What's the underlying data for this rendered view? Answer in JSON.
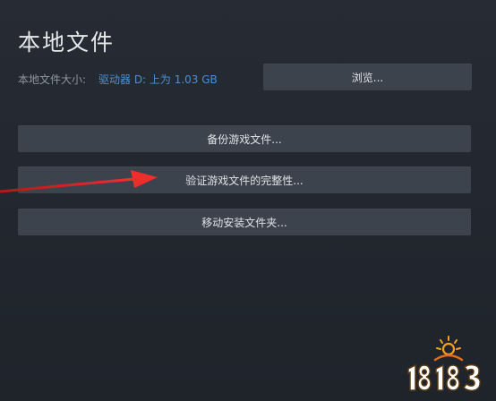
{
  "dialog": {
    "title": "本地文件",
    "size_label": "本地文件大小:",
    "size_value": "驱动器 D: 上为 1.03 GB"
  },
  "buttons": {
    "browse": "浏览...",
    "backup": "备份游戏文件...",
    "verify": "验证游戏文件的完整性...",
    "move": "移动安装文件夹..."
  },
  "annotation": {
    "arrow_color": "#e02626"
  },
  "watermark": {
    "text": "18183",
    "color_primary": "#f5a21b"
  }
}
